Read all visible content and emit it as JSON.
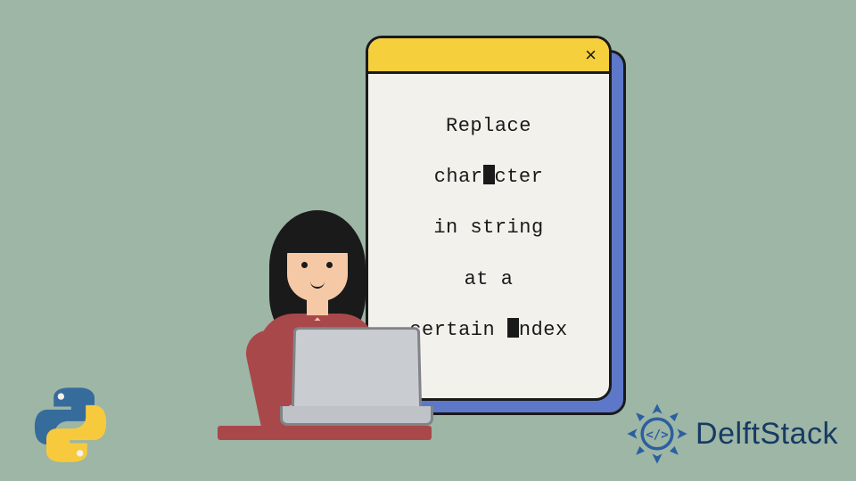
{
  "window": {
    "close_glyph": "×",
    "lines": {
      "l1a": "Replace",
      "l2a": "char",
      "l2b": "cter",
      "l3a": "in string",
      "l4a": "at a",
      "l5a": "certain ",
      "l5b": "ndex"
    }
  },
  "brand": {
    "name": "DelftStack"
  },
  "colors": {
    "bg": "#9db6a5",
    "window_titlebar": "#f5cf3c",
    "window_body": "#f3f1ec",
    "window_shadow": "#5d78c8",
    "border": "#1a1a1a",
    "shirt": "#a9484a",
    "skin": "#f6c9a6",
    "laptop": "#c9ccd0",
    "brand_text": "#173a63",
    "python_blue": "#366c9c",
    "python_yellow": "#f7ca3e"
  }
}
